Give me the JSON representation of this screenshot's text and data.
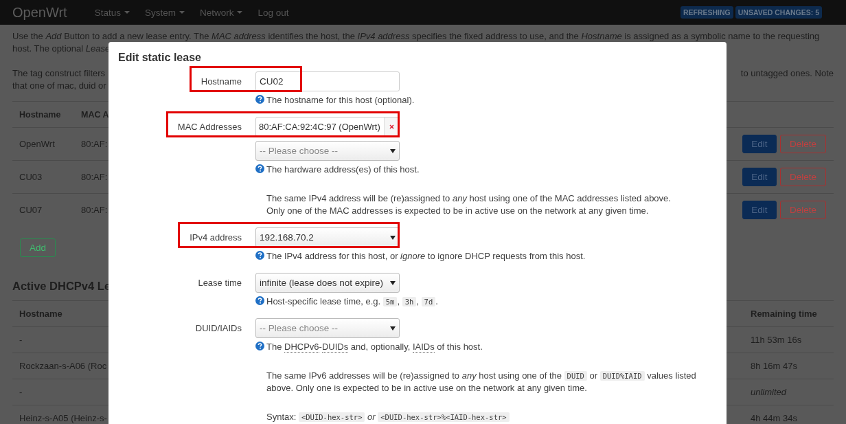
{
  "header": {
    "brand": "OpenWrt",
    "menus": [
      {
        "label": "Status",
        "dropdown": true
      },
      {
        "label": "System",
        "dropdown": true
      },
      {
        "label": "Network",
        "dropdown": true
      },
      {
        "label": "Log out",
        "dropdown": false
      }
    ],
    "badges": [
      "REFRESHING",
      "UNSAVED CHANGES: 5"
    ]
  },
  "intro": {
    "line_1": "Use the *Add* Button to add a new lease entry. The *MAC address* identifies the host, the *IPv4 address* specifies the fixed address to use, and the *Hostname* is assigned as a symbolic name to the requesting",
    "line_2": "host. The optional *Lease*",
    "tag_note_left": [
      "The tag construct filters",
      "that one of mac, duid or"
    ],
    "tag_note_right": "to untagged ones. Note"
  },
  "static_leases": {
    "columns": [
      "Hostname",
      "MAC A"
    ],
    "rows": [
      {
        "hostname": "OpenWrt",
        "mac": "80:AF:",
        "actions": [
          "Edit",
          "Delete"
        ]
      },
      {
        "hostname": "CU03",
        "mac": "80:AF:",
        "actions": [
          "Edit",
          "Delete"
        ]
      },
      {
        "hostname": "CU07",
        "mac": "80:AF:",
        "actions": [
          "Edit",
          "Delete"
        ]
      }
    ],
    "add_button": "Add"
  },
  "active_leases": {
    "title": "Active DHCPv4 Le",
    "columns": {
      "hostname": "Hostname",
      "remaining": "Remaining time"
    },
    "rows": [
      {
        "hostname": "-",
        "remaining": "11h 53m 16s",
        "italic": false
      },
      {
        "hostname": "Rockzaan-s-A06 (Roc",
        "remaining": "8h 16m 47s",
        "italic": false
      },
      {
        "hostname": "-",
        "remaining": "unlimited",
        "italic": true
      },
      {
        "hostname": "Heinz-s-A05 (Heinz-s-",
        "remaining": "4h 44m 34s",
        "italic": false
      }
    ]
  },
  "dialog": {
    "title": "Edit static lease",
    "fields": [
      {
        "kind": "text",
        "label": "Hostname",
        "value": "CU02",
        "highlighted": true,
        "help": [
          {
            "kind": "text",
            "text": "The hostname for this host (optional)."
          }
        ]
      },
      {
        "kind": "dynlist",
        "label": "MAC Addresses",
        "items": [
          "80:AF:CA:92:4C:97 (OpenWrt)"
        ],
        "placeholder": "-- Please choose --",
        "highlighted": true,
        "help": [
          {
            "kind": "text",
            "text": "The hardware address(es) of this host."
          }
        ],
        "notes": [
          {
            "lines": [
              [
                {
                  "kind": "text",
                  "text": "The same IPv4 address will be (re)assigned to "
                },
                {
                  "kind": "em",
                  "text": "any"
                },
                {
                  "kind": "text",
                  "text": " host using one of the MAC addresses listed above."
                }
              ],
              [
                {
                  "kind": "text",
                  "text": "Only one of the MAC addresses is expected to be in active use on the network at any given time."
                }
              ]
            ]
          }
        ]
      },
      {
        "kind": "select",
        "label": "IPv4 address",
        "value": "192.168.70.2",
        "highlighted": true,
        "help": [
          {
            "kind": "text",
            "text": "The IPv4 address for this host, or "
          },
          {
            "kind": "em",
            "text": "ignore"
          },
          {
            "kind": "text",
            "text": " to ignore DHCP requests from this host."
          }
        ]
      },
      {
        "kind": "select",
        "label": "Lease time",
        "value": "infinite (lease does not expire)",
        "highlighted": false,
        "help": [
          {
            "kind": "text",
            "text": "Host-specific lease time, e.g. "
          },
          {
            "kind": "code",
            "text": "5m"
          },
          {
            "kind": "text",
            "text": ", "
          },
          {
            "kind": "code",
            "text": "3h"
          },
          {
            "kind": "text",
            "text": ", "
          },
          {
            "kind": "code",
            "text": "7d"
          },
          {
            "kind": "text",
            "text": "."
          }
        ]
      },
      {
        "kind": "select",
        "label": "DUID/IAIDs",
        "placeholder": "-- Please choose --",
        "highlighted": false,
        "help": [
          {
            "kind": "text",
            "text": "The "
          },
          {
            "kind": "abbr",
            "text": "DHCPv6"
          },
          {
            "kind": "text",
            "text": "-"
          },
          {
            "kind": "abbr",
            "text": "DUIDs"
          },
          {
            "kind": "text",
            "text": " and, optionally, "
          },
          {
            "kind": "abbr",
            "text": "IAIDs"
          },
          {
            "kind": "text",
            "text": " of this host."
          }
        ],
        "notes": [
          {
            "lines": [
              [
                {
                  "kind": "text",
                  "text": "The same IPv6 addresses will be (re)assigned to "
                },
                {
                  "kind": "em",
                  "text": "any"
                },
                {
                  "kind": "text",
                  "text": " host using one of the "
                },
                {
                  "kind": "code",
                  "text": "DUID"
                },
                {
                  "kind": "text",
                  "text": " or "
                },
                {
                  "kind": "code",
                  "text": "DUID%IAID"
                },
                {
                  "kind": "text",
                  "text": " values listed above. Only one is expected to be in active use on the network at any given time."
                }
              ]
            ]
          },
          {
            "lines": [
              [
                {
                  "kind": "text",
                  "text": "Syntax: "
                },
                {
                  "kind": "code",
                  "text": "<DUID-hex-str>"
                },
                {
                  "kind": "em_word",
                  "text": "or"
                },
                {
                  "kind": "code",
                  "text": "<DUID-hex-str>%<IAID-hex-str>"
                }
              ]
            ]
          }
        ]
      }
    ]
  }
}
